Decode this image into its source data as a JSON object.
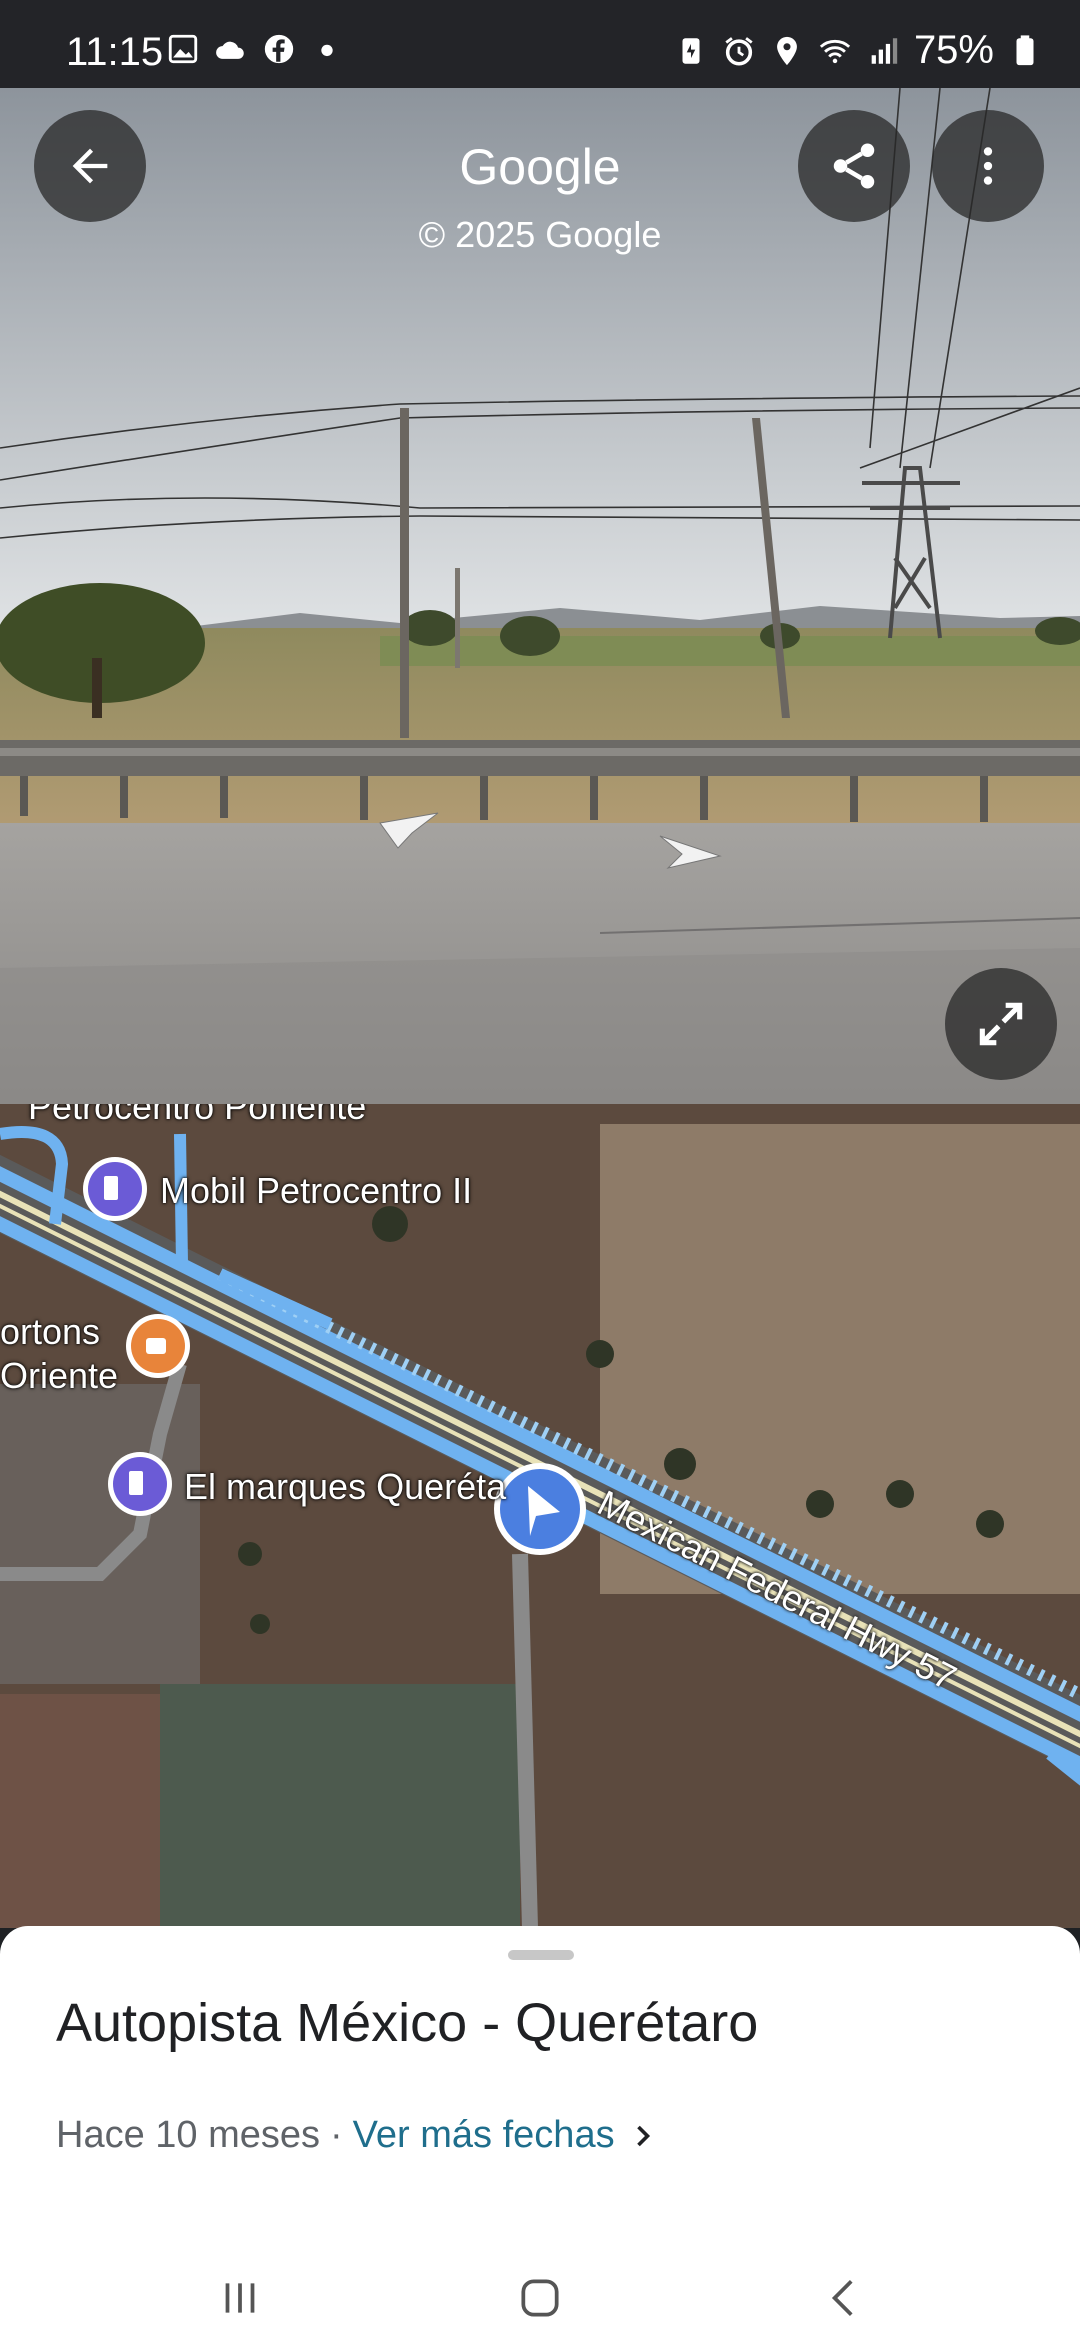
{
  "status_bar": {
    "time": "11:15",
    "battery": "75%"
  },
  "street_view": {
    "title": "Google",
    "copyright": "© 2025 Google"
  },
  "map": {
    "pois": [
      {
        "label": "Petrocentro Poniente"
      },
      {
        "label": "Mobil Petrocentro II"
      },
      {
        "label": "ortons\nOriente"
      },
      {
        "label": "El marques Queréta"
      }
    ],
    "road_label": "Mexican Federal Hwy 57"
  },
  "sheet": {
    "place_name": "Autopista México - Querétaro",
    "date_text": "Hace 10 meses",
    "separator": "·",
    "more_dates": "Ver más fechas"
  },
  "colors": {
    "accent": "#4285f4",
    "link": "#1f6e8c",
    "poi_purple": "#6b5bd6",
    "poi_orange": "#e8843a"
  }
}
